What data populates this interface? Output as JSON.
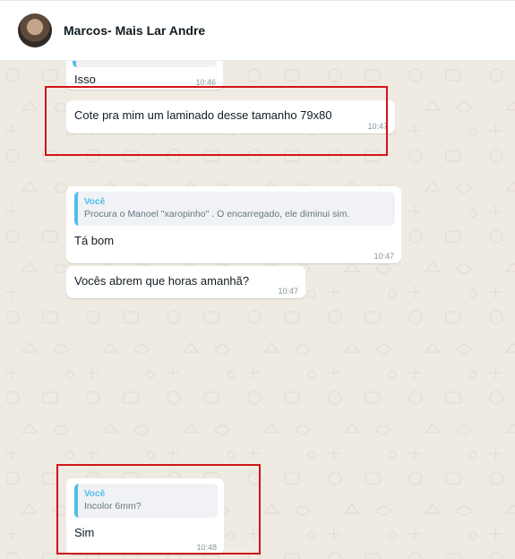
{
  "header": {
    "contact_name": "Marcos- Mais Lar Andre"
  },
  "messages": [
    {
      "text": "Isso",
      "time": "10:46"
    },
    {
      "text": "Cote pra mim um laminado desse tamanho 79x80",
      "time": "10:47"
    },
    {
      "quote_author": "Você",
      "quote_text": "Procura o Manoel \"xaropinho\" . O encarregado, ele diminui sim.",
      "text": "Tá bom",
      "time": "10:47"
    },
    {
      "text": "Vocês abrem que horas amanhã?",
      "time": "10:47"
    },
    {
      "quote_author": "Você",
      "quote_text": "Incolor 6mm?",
      "text": "Sim",
      "time": "10:48"
    }
  ],
  "colors": {
    "chat_background": "#efeae2",
    "bubble": "#ffffff",
    "quote_accent": "#53bdeb",
    "highlight_box": "#d0141a"
  }
}
